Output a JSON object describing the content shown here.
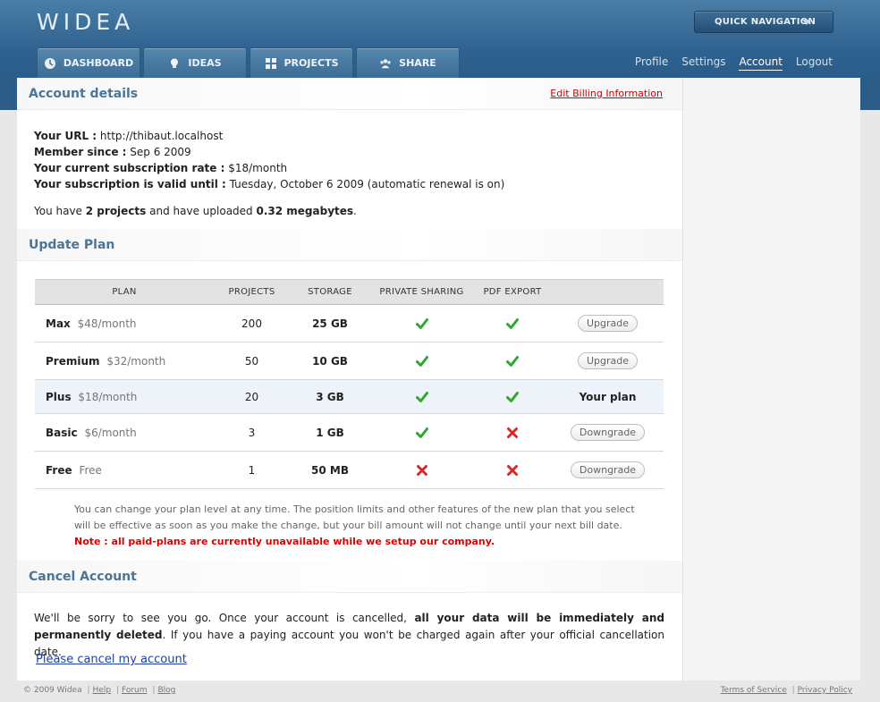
{
  "header": {
    "logo": "WIDEA",
    "quick_nav": "QUICK NAVIGATION",
    "tabs": [
      {
        "label": "DASHBOARD",
        "icon": "dashboard-icon"
      },
      {
        "label": "IDEAS",
        "icon": "lightbulb-icon"
      },
      {
        "label": "PROJECTS",
        "icon": "grid-icon"
      },
      {
        "label": "SHARE",
        "icon": "people-icon"
      }
    ],
    "links": [
      "Profile",
      "Settings",
      "Account",
      "Logout"
    ],
    "active_link": "Account"
  },
  "account": {
    "title": "Account details",
    "billing_link": "Edit Billing Information",
    "url_label": "Your URL :",
    "url_value": "http://thibaut.localhost",
    "member_label": "Member since :",
    "member_value": "Sep 6 2009",
    "rate_label": "Your current subscription rate :",
    "rate_value": "$18/month",
    "valid_label": "Your subscription is valid until :",
    "valid_value": "Tuesday, October 6 2009 (automatic renewal is on)",
    "usage_pre": "You have",
    "usage_projects": "2 projects",
    "usage_mid": "and have uploaded",
    "usage_size": "0.32 megabytes",
    "usage_end": "."
  },
  "plan": {
    "title": "Update Plan",
    "headers": [
      "PLAN",
      "PROJECTS",
      "STORAGE",
      "PRIVATE SHARING",
      "PDF EXPORT",
      ""
    ],
    "rows": [
      {
        "name": "Max",
        "price": "$48/month",
        "projects": "200",
        "storage": "25 GB",
        "private": true,
        "pdf": true,
        "action": "Upgrade"
      },
      {
        "name": "Premium",
        "price": "$32/month",
        "projects": "50",
        "storage": "10 GB",
        "private": true,
        "pdf": true,
        "action": "Upgrade"
      },
      {
        "name": "Plus",
        "price": "$18/month",
        "projects": "20",
        "storage": "3 GB",
        "private": true,
        "pdf": true,
        "action": "Your plan"
      },
      {
        "name": "Basic",
        "price": "$6/month",
        "projects": "3",
        "storage": "1 GB",
        "private": true,
        "pdf": false,
        "action": "Downgrade"
      },
      {
        "name": "Free",
        "price": "Free",
        "projects": "1",
        "storage": "50 MB",
        "private": false,
        "pdf": false,
        "action": "Downgrade"
      }
    ],
    "note_line1": "You can change your plan level at any time. The position limits and other features of the new plan that you select",
    "note_line2": "will be effective as soon as you make the change, but your bill amount will not change until your next bill date.",
    "note_warning": "Note : all paid-plans are currently unavailable while we setup our company."
  },
  "cancel": {
    "title": "Cancel Account",
    "text_pre": "We'll be sorry to see you go. Once your account is cancelled,",
    "text_bold": "all your data will be immediately and permanently deleted",
    "text_post": ". If you have a paying account you won't be charged again after your official cancellation date.",
    "link": "Please cancel my account"
  },
  "footer": {
    "copyright": "© 2009 Widea",
    "links_left": [
      "Help",
      "Forum",
      "Blog"
    ],
    "links_right": [
      "Terms of Service",
      "Privacy Policy"
    ]
  },
  "colors": {
    "header_blue": "#2f6290",
    "section_title": "#4b7596",
    "check_green": "#2fa82f",
    "cross_red": "#d42a2a",
    "warning_red": "#dd0000"
  }
}
